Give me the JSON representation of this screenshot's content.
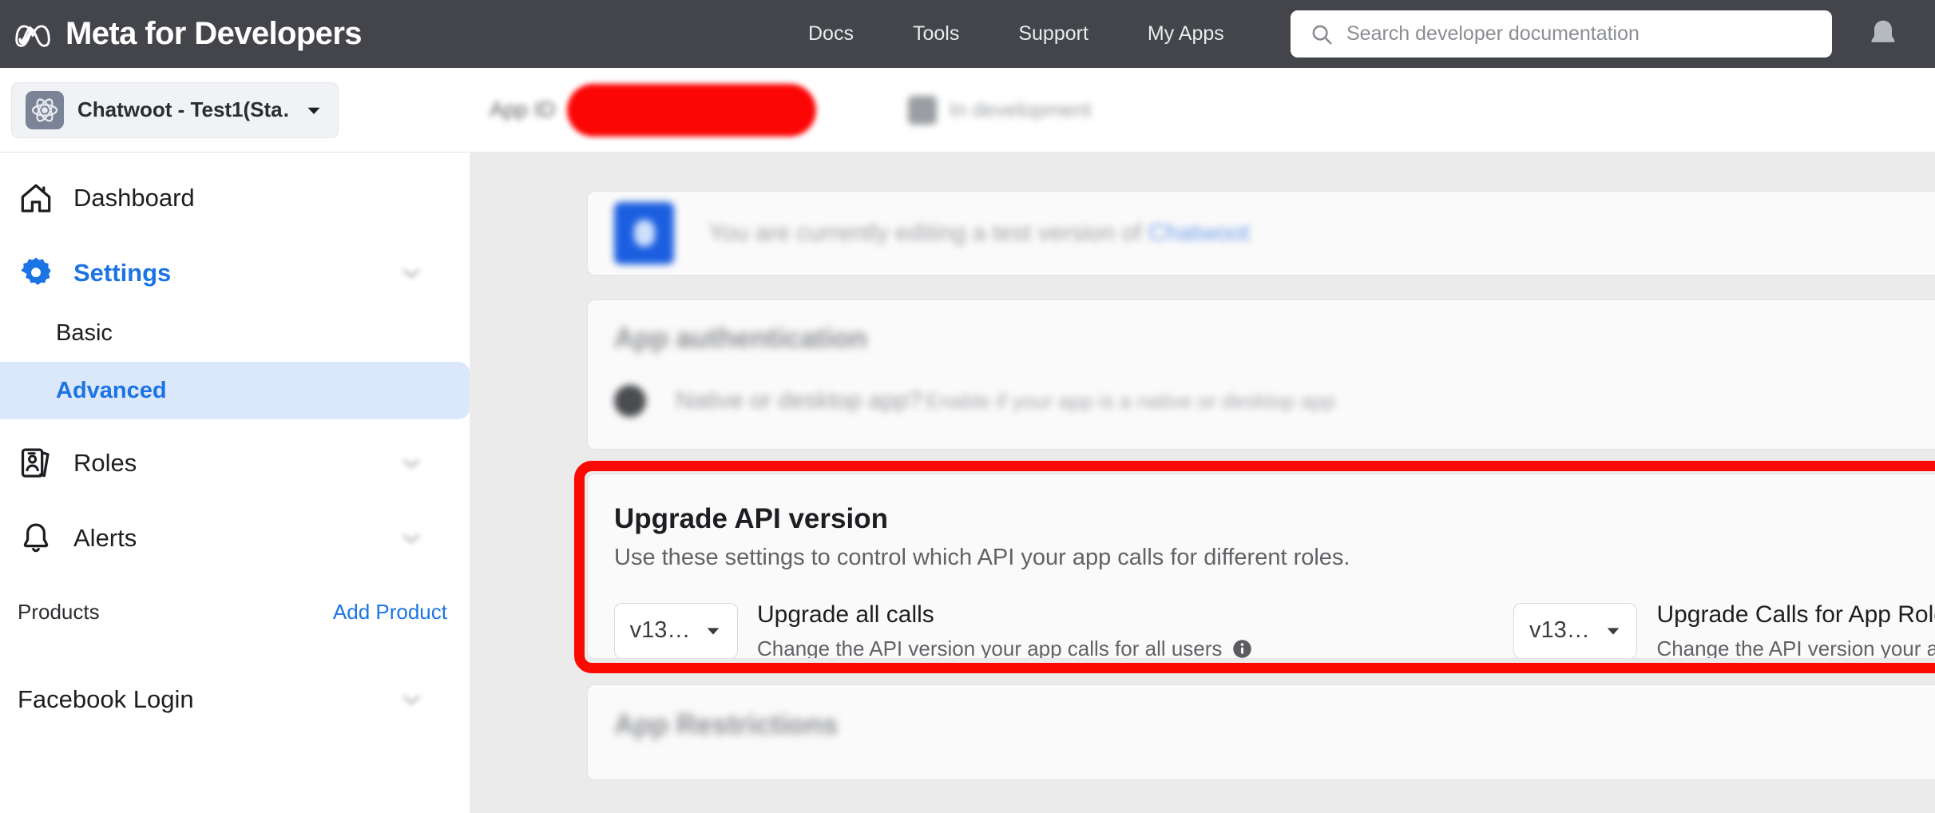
{
  "topbar": {
    "brand": "Meta for Developers",
    "brand_icon": "meta-infinity-logo",
    "nav": [
      {
        "label": "Docs"
      },
      {
        "label": "Tools"
      },
      {
        "label": "Support"
      },
      {
        "label": "My Apps"
      }
    ],
    "search": {
      "icon": "search-icon",
      "placeholder": "Search developer documentation",
      "value": ""
    },
    "notifications_icon": "bell-icon",
    "background_color": "#43454a"
  },
  "sidebar": {
    "app_switcher": {
      "app_icon": "app-atom-icon",
      "app_name": "Chatwoot - Test1(Sta…",
      "caret_icon": "chevron-down-icon"
    },
    "items": [
      {
        "label": "Dashboard",
        "icon": "home-icon",
        "active": false
      },
      {
        "label": "Settings",
        "icon": "gear-icon",
        "active": true
      }
    ],
    "settings_children": [
      {
        "label": "Basic",
        "active": false
      },
      {
        "label": "Advanced",
        "active": true
      }
    ],
    "items_after": [
      {
        "label": "Roles",
        "icon": "id-badge-icon",
        "active": false
      },
      {
        "label": "Alerts",
        "icon": "bell-outline-icon",
        "active": false
      }
    ],
    "products_header": {
      "label": "Products",
      "action_label": "Add Product"
    },
    "products": [
      {
        "label": "Facebook Login"
      }
    ],
    "accent_color": "#1b74e4",
    "active_pill_color": "#dbe7fb"
  },
  "content": {
    "appid_bar": {
      "label": "App ID",
      "value_redacted": true,
      "redaction_color": "#fc0505",
      "extra_label": "In development"
    },
    "banner": {
      "icon": "info-badge-icon",
      "text": "You are currently editing a test version of ",
      "link_text": "Chatwoot",
      "blurred": true
    },
    "auth_card": {
      "title": "App authentication",
      "row_title": "Native or desktop app?",
      "row_subtitle": "Enable if your app is a native or desktop app",
      "blurred": true
    },
    "upgrade_card": {
      "highlighted": true,
      "highlight_color": "#fa0a00",
      "title": "Upgrade API version",
      "subtitle": "Use these settings to control which API your app calls for different roles.",
      "controls": [
        {
          "dropdown_value": "v13…",
          "dropdown_caret_icon": "chevron-down-icon",
          "title": "Upgrade all calls",
          "subtitle": "Change the API version your app calls for all users",
          "info_icon": "info-circle-icon",
          "has_info_icon": true
        },
        {
          "dropdown_value": "v13…",
          "dropdown_caret_icon": "chevron-down-icon",
          "title": "Upgrade Calls for App Roles",
          "subtitle": "Change the API version your app calls for devel",
          "has_info_icon": false
        }
      ]
    },
    "restrictions_card": {
      "title": "App Restrictions",
      "blurred": true
    },
    "background_color": "#ebebeb"
  }
}
